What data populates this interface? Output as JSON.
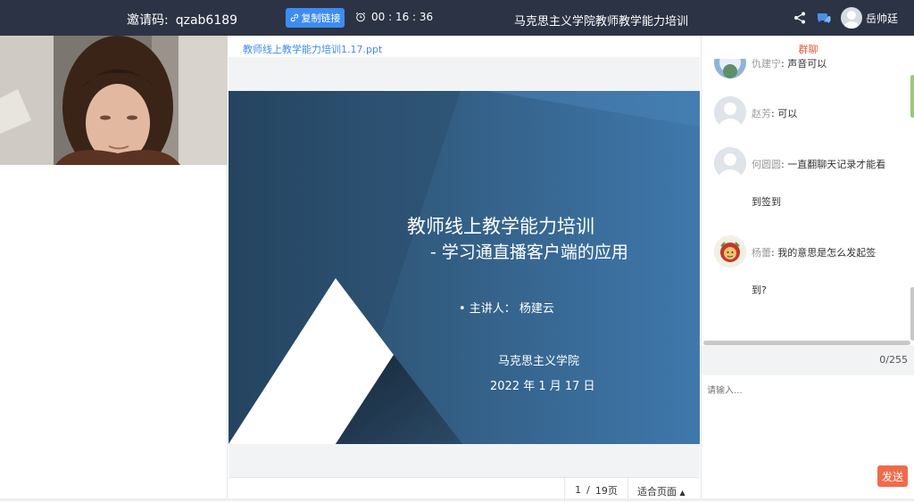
{
  "header": {
    "invite_label": "邀请码:",
    "invite_code": "qzab6189",
    "copy_link_label": "复制链接",
    "timer": "00 : 16 : 36",
    "title": "马克思主义学院教师教学能力培训",
    "username": "岳帅廷"
  },
  "document": {
    "file_name": "教师线上教学能力培训1.17.ppt",
    "slide": {
      "title": "教师线上教学能力培训",
      "subtitle": "- 学习通直播客户端的应用",
      "presenter": "• 主讲人： 杨建云",
      "org": "马克思主义学院",
      "date": "2022 年 1 月 17 日"
    },
    "current_page": "1",
    "separator": "/",
    "total_pages": "19页",
    "fit_label": "适合页面"
  },
  "chat": {
    "tab_label": "群聊",
    "messages": [
      {
        "name": "仇建宁",
        "sep": ":",
        "text": "声音可以",
        "text2": ""
      },
      {
        "name": "赵芳",
        "sep": ":",
        "text": "可以",
        "text2": ""
      },
      {
        "name": "何圆圆",
        "sep": ":",
        "text": "一直翻聊天记录才能看",
        "text2": "到签到"
      },
      {
        "name": "杨蕾",
        "sep": ":",
        "text": "我的意思是怎么发起签",
        "text2": "到?"
      }
    ],
    "counter": "0/255",
    "input_placeholder": "请输入...",
    "send_label": "发送"
  },
  "colors": {
    "topbar": "#2c3345",
    "accent": "#3d8cf2",
    "send": "#f06b4a",
    "chat_tab": "#e05a3a"
  }
}
